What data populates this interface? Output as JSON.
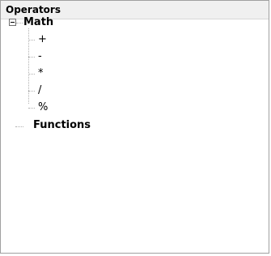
{
  "panel": {
    "title": "Operators"
  },
  "tree": {
    "root": {
      "label": "Math",
      "expanded": true,
      "children": [
        {
          "label": "+"
        },
        {
          "label": "-"
        },
        {
          "label": "*"
        },
        {
          "label": "/"
        },
        {
          "label": "%"
        }
      ]
    },
    "functions": {
      "label": "Functions"
    }
  }
}
